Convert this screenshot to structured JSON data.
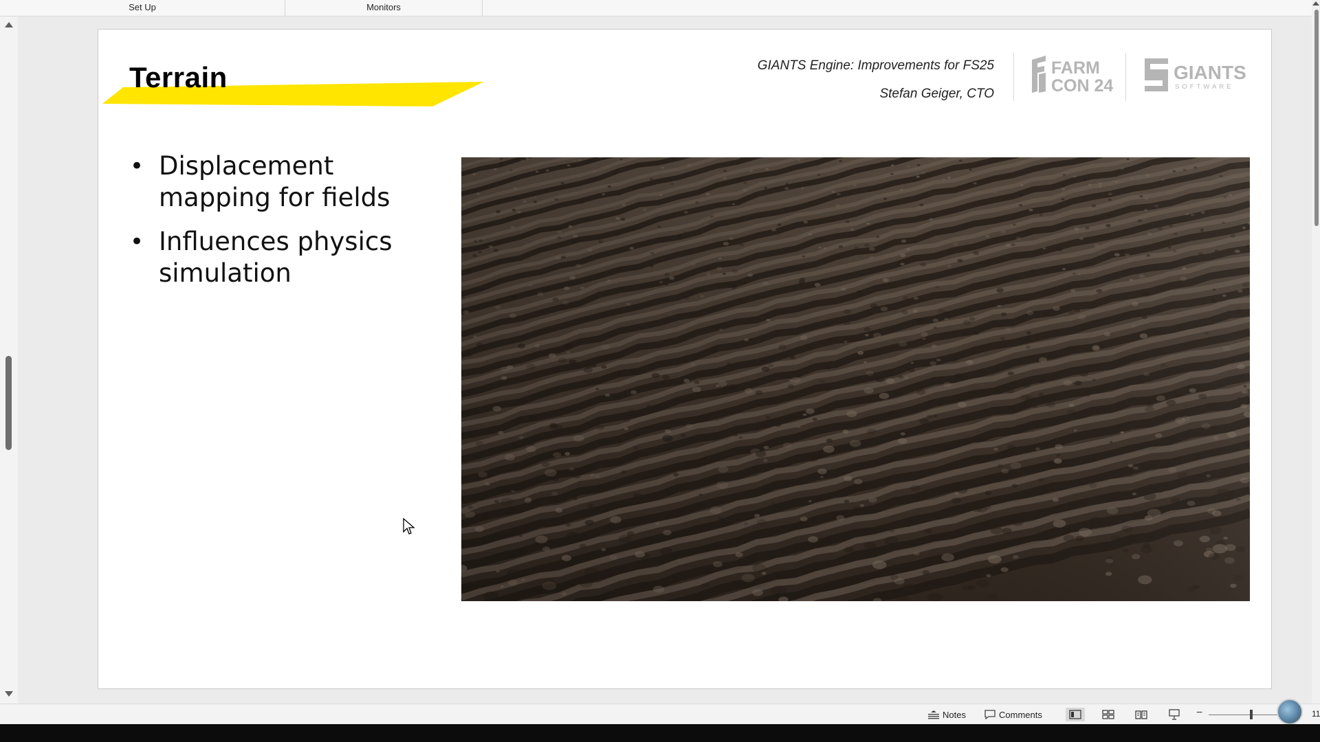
{
  "ribbon": {
    "groups": [
      {
        "label": "Set Up"
      },
      {
        "label": "Monitors"
      }
    ]
  },
  "slide": {
    "title": "Terrain",
    "talk_title": "GIANTS Engine: Improvements for FS25",
    "author": "Stefan Geiger, CTO",
    "logos": {
      "farmcon_line1": "FARM",
      "farmcon_line2": "CON 24",
      "giants_line1": "GIANTS",
      "giants_line2": "SOFTWARE"
    },
    "bullets": [
      {
        "text": "Displacement mapping for fields"
      },
      {
        "text": "Influences physics simulation"
      }
    ],
    "accent_color": "#ffe500"
  },
  "statusbar": {
    "notes_label": "Notes",
    "comments_label": "Comments",
    "zoom_partial": "11"
  }
}
